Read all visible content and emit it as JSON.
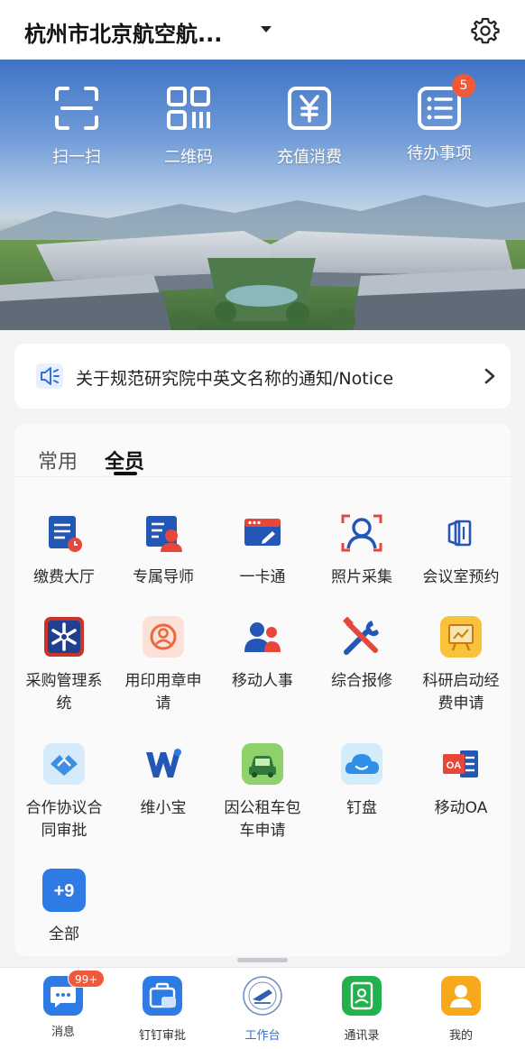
{
  "header": {
    "org_title": "杭州市北京航空航...",
    "settings_icon": "gear-icon"
  },
  "quick_actions": [
    {
      "label": "扫一扫",
      "icon": "scan-icon"
    },
    {
      "label": "二维码",
      "icon": "qrcode-icon"
    },
    {
      "label": "充值消费",
      "icon": "yen-icon"
    },
    {
      "label": "待办事项",
      "icon": "todo-list-icon",
      "badge": "5"
    }
  ],
  "notice": {
    "text": "关于规范研究院中英文名称的通知/Notice",
    "icon": "speaker-icon"
  },
  "tabs": [
    {
      "label": "常用"
    },
    {
      "label": "全员",
      "active": true
    }
  ],
  "apps": [
    {
      "label": "缴费大厅",
      "icon": "payment-hall-icon"
    },
    {
      "label": "专属导师",
      "icon": "mentor-icon"
    },
    {
      "label": "一卡通",
      "icon": "campus-card-icon"
    },
    {
      "label": "照片采集",
      "icon": "photo-capture-icon"
    },
    {
      "label": "会议室预约",
      "icon": "meeting-room-icon"
    },
    {
      "label": "采购管理系统",
      "icon": "procurement-icon"
    },
    {
      "label": "用印用章申请",
      "icon": "seal-icon"
    },
    {
      "label": "移动人事",
      "icon": "hr-icon"
    },
    {
      "label": "综合报修",
      "icon": "repair-icon"
    },
    {
      "label": "科研启动经费申请",
      "icon": "research-funding-icon"
    },
    {
      "label": "合作协议合同审批",
      "icon": "contract-icon"
    },
    {
      "label": "维小宝",
      "icon": "weixiaobao-icon"
    },
    {
      "label": "因公租车包车申请",
      "icon": "car-rental-icon"
    },
    {
      "label": "钉盘",
      "icon": "cloud-drive-icon"
    },
    {
      "label": "移动OA",
      "icon": "mobile-oa-icon",
      "icon_text": "OA"
    },
    {
      "label": "全部",
      "icon": "all-apps-icon",
      "icon_text": "+9"
    }
  ],
  "bottom_nav": [
    {
      "label": "消息",
      "icon": "message-icon",
      "badge": "99+"
    },
    {
      "label": "钉钉审批",
      "icon": "approval-icon"
    },
    {
      "label": "工作台",
      "icon": "university-logo-icon",
      "active": true
    },
    {
      "label": "通讯录",
      "icon": "contacts-icon"
    },
    {
      "label": "我的",
      "icon": "profile-icon"
    }
  ],
  "colors": {
    "accent": "#2f6fe0",
    "badge": "#f05a3a"
  }
}
